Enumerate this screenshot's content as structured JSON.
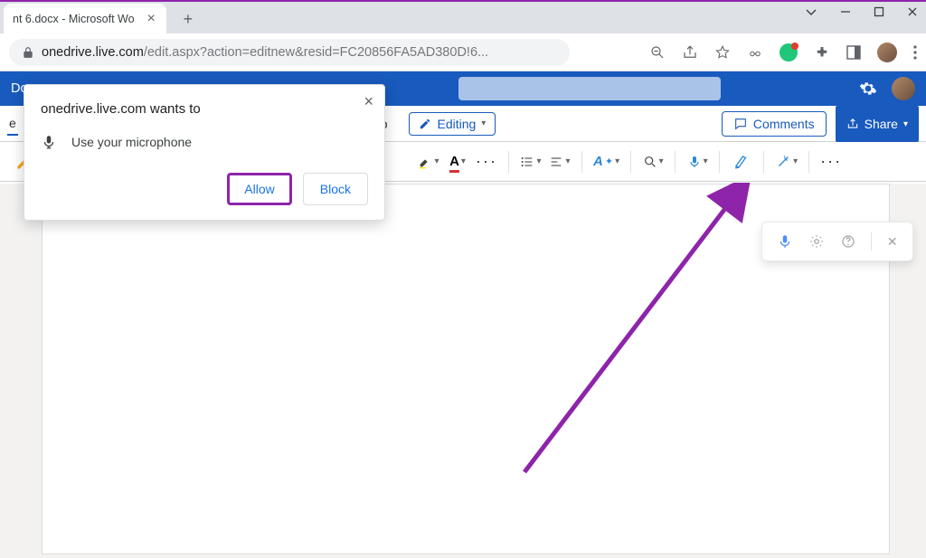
{
  "browser": {
    "tab_title": "nt 6.docx - Microsoft Wo",
    "url_host": "onedrive.live.com",
    "url_path": "/edit.aspx?action=editnew&resid=FC20856FA5AD380D!6..."
  },
  "app": {
    "title_edge": "Do",
    "ribbon_tab_fragment": "e",
    "help_label": "elp",
    "editing_label": "Editing",
    "comments_label": "Comments",
    "share_label": "Share"
  },
  "toolbar": {
    "brush": "format-painter",
    "highlight": "text-highlight",
    "font_color": "font-color",
    "bullets": "bullets",
    "align": "align",
    "styles": "styles",
    "find": "find",
    "dictate": "dictate",
    "editor": "editor",
    "designer": "designer"
  },
  "permission": {
    "title": "onedrive.live.com wants to",
    "line": "Use your microphone",
    "allow": "Allow",
    "block": "Block"
  }
}
